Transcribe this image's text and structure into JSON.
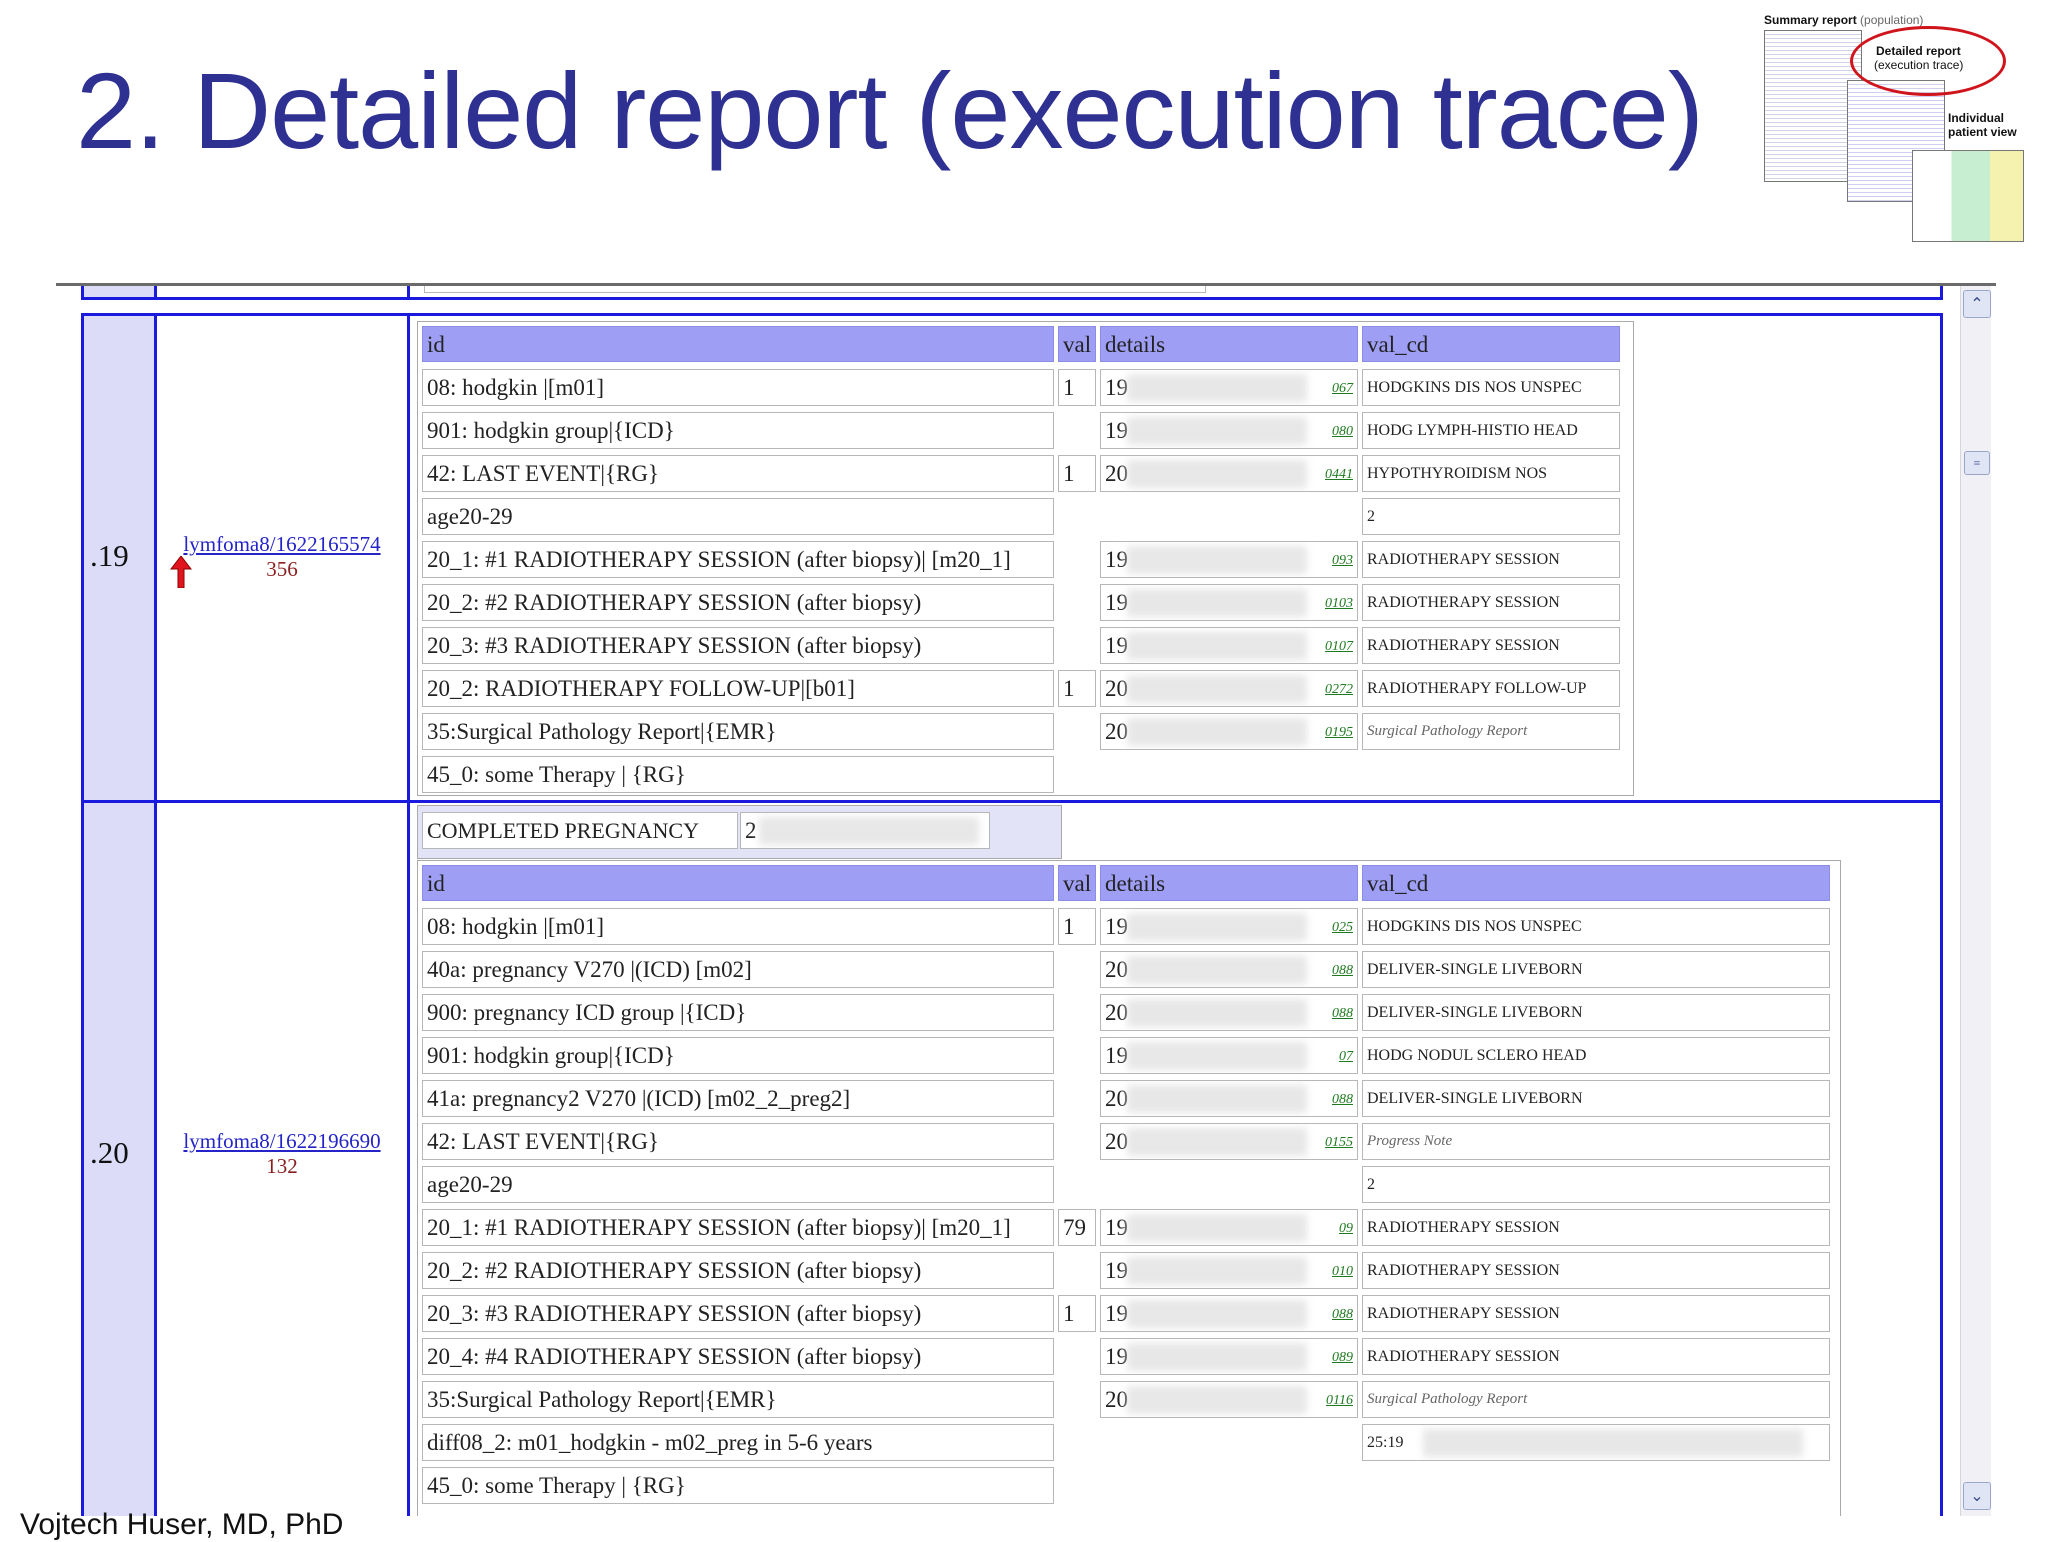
{
  "slide": {
    "title": "2. Detailed report (execution trace)",
    "footer": "Vojtech Huser, MD, PhD"
  },
  "thumbnail": {
    "summary_bold": "Summary report",
    "summary_rest": "(population)",
    "detailed": "Detailed report",
    "detailed_sub": "(execution trace)",
    "individual": "Individual",
    "individual_sub": "patient view",
    "highlight_color": "#d0141c"
  },
  "report": {
    "headers": {
      "id": "id",
      "val": "val",
      "details": "details",
      "val_cd": "val_cd"
    },
    "rows": [
      {
        "num": ".19",
        "patient_link": "lymfoma8/1622165574",
        "count": "356",
        "events": [
          {
            "id": "08: hodgkin |[m01]",
            "val": "1",
            "details": "19",
            "link": "067",
            "val_cd": "HODGKINS DIS NOS UNSPEC"
          },
          {
            "id": "901: hodgkin group|{ICD}",
            "val": "",
            "details": "19",
            "link": "080",
            "val_cd": "HODG LYMPH-HISTIO HEAD"
          },
          {
            "id": "42: LAST EVENT|{RG}",
            "val": "1",
            "details": "20",
            "link": "0441",
            "val_cd": "HYPOTHYROIDISM NOS"
          },
          {
            "id": "age20-29",
            "val": "",
            "details": "",
            "link": "",
            "val_cd": "2"
          },
          {
            "id": "20_1: #1 RADIOTHERAPY SESSION (after biopsy)| [m20_1]",
            "val": "",
            "details": "19",
            "link": "093",
            "val_cd": "RADIOTHERAPY SESSION"
          },
          {
            "id": "20_2: #2 RADIOTHERAPY SESSION (after biopsy)",
            "val": "",
            "details": "19",
            "link": "0103",
            "val_cd": "RADIOTHERAPY SESSION"
          },
          {
            "id": "20_3: #3 RADIOTHERAPY SESSION (after biopsy)",
            "val": "",
            "details": "19",
            "link": "0107",
            "val_cd": "RADIOTHERAPY SESSION"
          },
          {
            "id": "20_2: RADIOTHERAPY FOLLOW-UP|[b01]",
            "val": "1",
            "details": "20",
            "link": "0272",
            "val_cd": "RADIOTHERAPY FOLLOW-UP"
          },
          {
            "id": "35:Surgical Pathology Report|{EMR}",
            "val": "",
            "details": "20",
            "link": "0195",
            "val_cd": "Surgical Pathology Report",
            "val_cd_italic": true
          },
          {
            "id": "45_0: some Therapy | {RG}",
            "val": "",
            "details": "",
            "link": "",
            "val_cd": ""
          }
        ]
      },
      {
        "num": ".20",
        "patient_link": "lymfoma8/1622196690",
        "count": "132",
        "pregnancy_label": "COMPLETED PREGNANCY",
        "pregnancy_value": "2",
        "events": [
          {
            "id": "08: hodgkin |[m01]",
            "val": "1",
            "details": "19",
            "link": "025",
            "val_cd": "HODGKINS DIS NOS UNSPEC"
          },
          {
            "id": "40a: pregnancy V270 |(ICD) [m02]",
            "val": "",
            "details": "20",
            "link": "088",
            "val_cd": "DELIVER-SINGLE LIVEBORN"
          },
          {
            "id": "900: pregnancy ICD group |{ICD}",
            "val": "",
            "details": "20",
            "link": "088",
            "val_cd": "DELIVER-SINGLE LIVEBORN"
          },
          {
            "id": "901: hodgkin group|{ICD}",
            "val": "",
            "details": "19",
            "link": "07",
            "val_cd": "HODG NODUL SCLERO HEAD"
          },
          {
            "id": "41a: pregnancy2 V270 |(ICD) [m02_2_preg2]",
            "val": "",
            "details": "20",
            "link": "088",
            "val_cd": "DELIVER-SINGLE LIVEBORN"
          },
          {
            "id": "42: LAST EVENT|{RG}",
            "val": "",
            "details": "20",
            "link": "0155",
            "val_cd": "Progress Note",
            "val_cd_italic": true
          },
          {
            "id": "age20-29",
            "val": "",
            "details": "",
            "link": "",
            "val_cd": "2"
          },
          {
            "id": "20_1: #1 RADIOTHERAPY SESSION (after biopsy)| [m20_1]",
            "val": "79",
            "details": "19",
            "link": "09",
            "val_cd": "RADIOTHERAPY SESSION"
          },
          {
            "id": "20_2: #2 RADIOTHERAPY SESSION (after biopsy)",
            "val": "",
            "details": "19",
            "link": "010",
            "val_cd": "RADIOTHERAPY SESSION"
          },
          {
            "id": "20_3: #3 RADIOTHERAPY SESSION (after biopsy)",
            "val": "1",
            "details": "19",
            "link": "088",
            "val_cd": "RADIOTHERAPY SESSION"
          },
          {
            "id": "20_4: #4 RADIOTHERAPY SESSION (after biopsy)",
            "val": "",
            "details": "19",
            "link": "089",
            "val_cd": "RADIOTHERAPY SESSION"
          },
          {
            "id": "35:Surgical Pathology Report|{EMR}",
            "val": "",
            "details": "20",
            "link": "0116",
            "val_cd": "Surgical Pathology Report",
            "val_cd_italic": true
          },
          {
            "id": "diff08_2: m01_hodgkin - m02_preg in 5-6 years",
            "val": "",
            "details": "",
            "link": "",
            "val_cd": "25:19"
          },
          {
            "id": "45_0: some Therapy | {RG}",
            "val": "",
            "details": "",
            "link": "",
            "val_cd": ""
          }
        ]
      }
    ]
  }
}
